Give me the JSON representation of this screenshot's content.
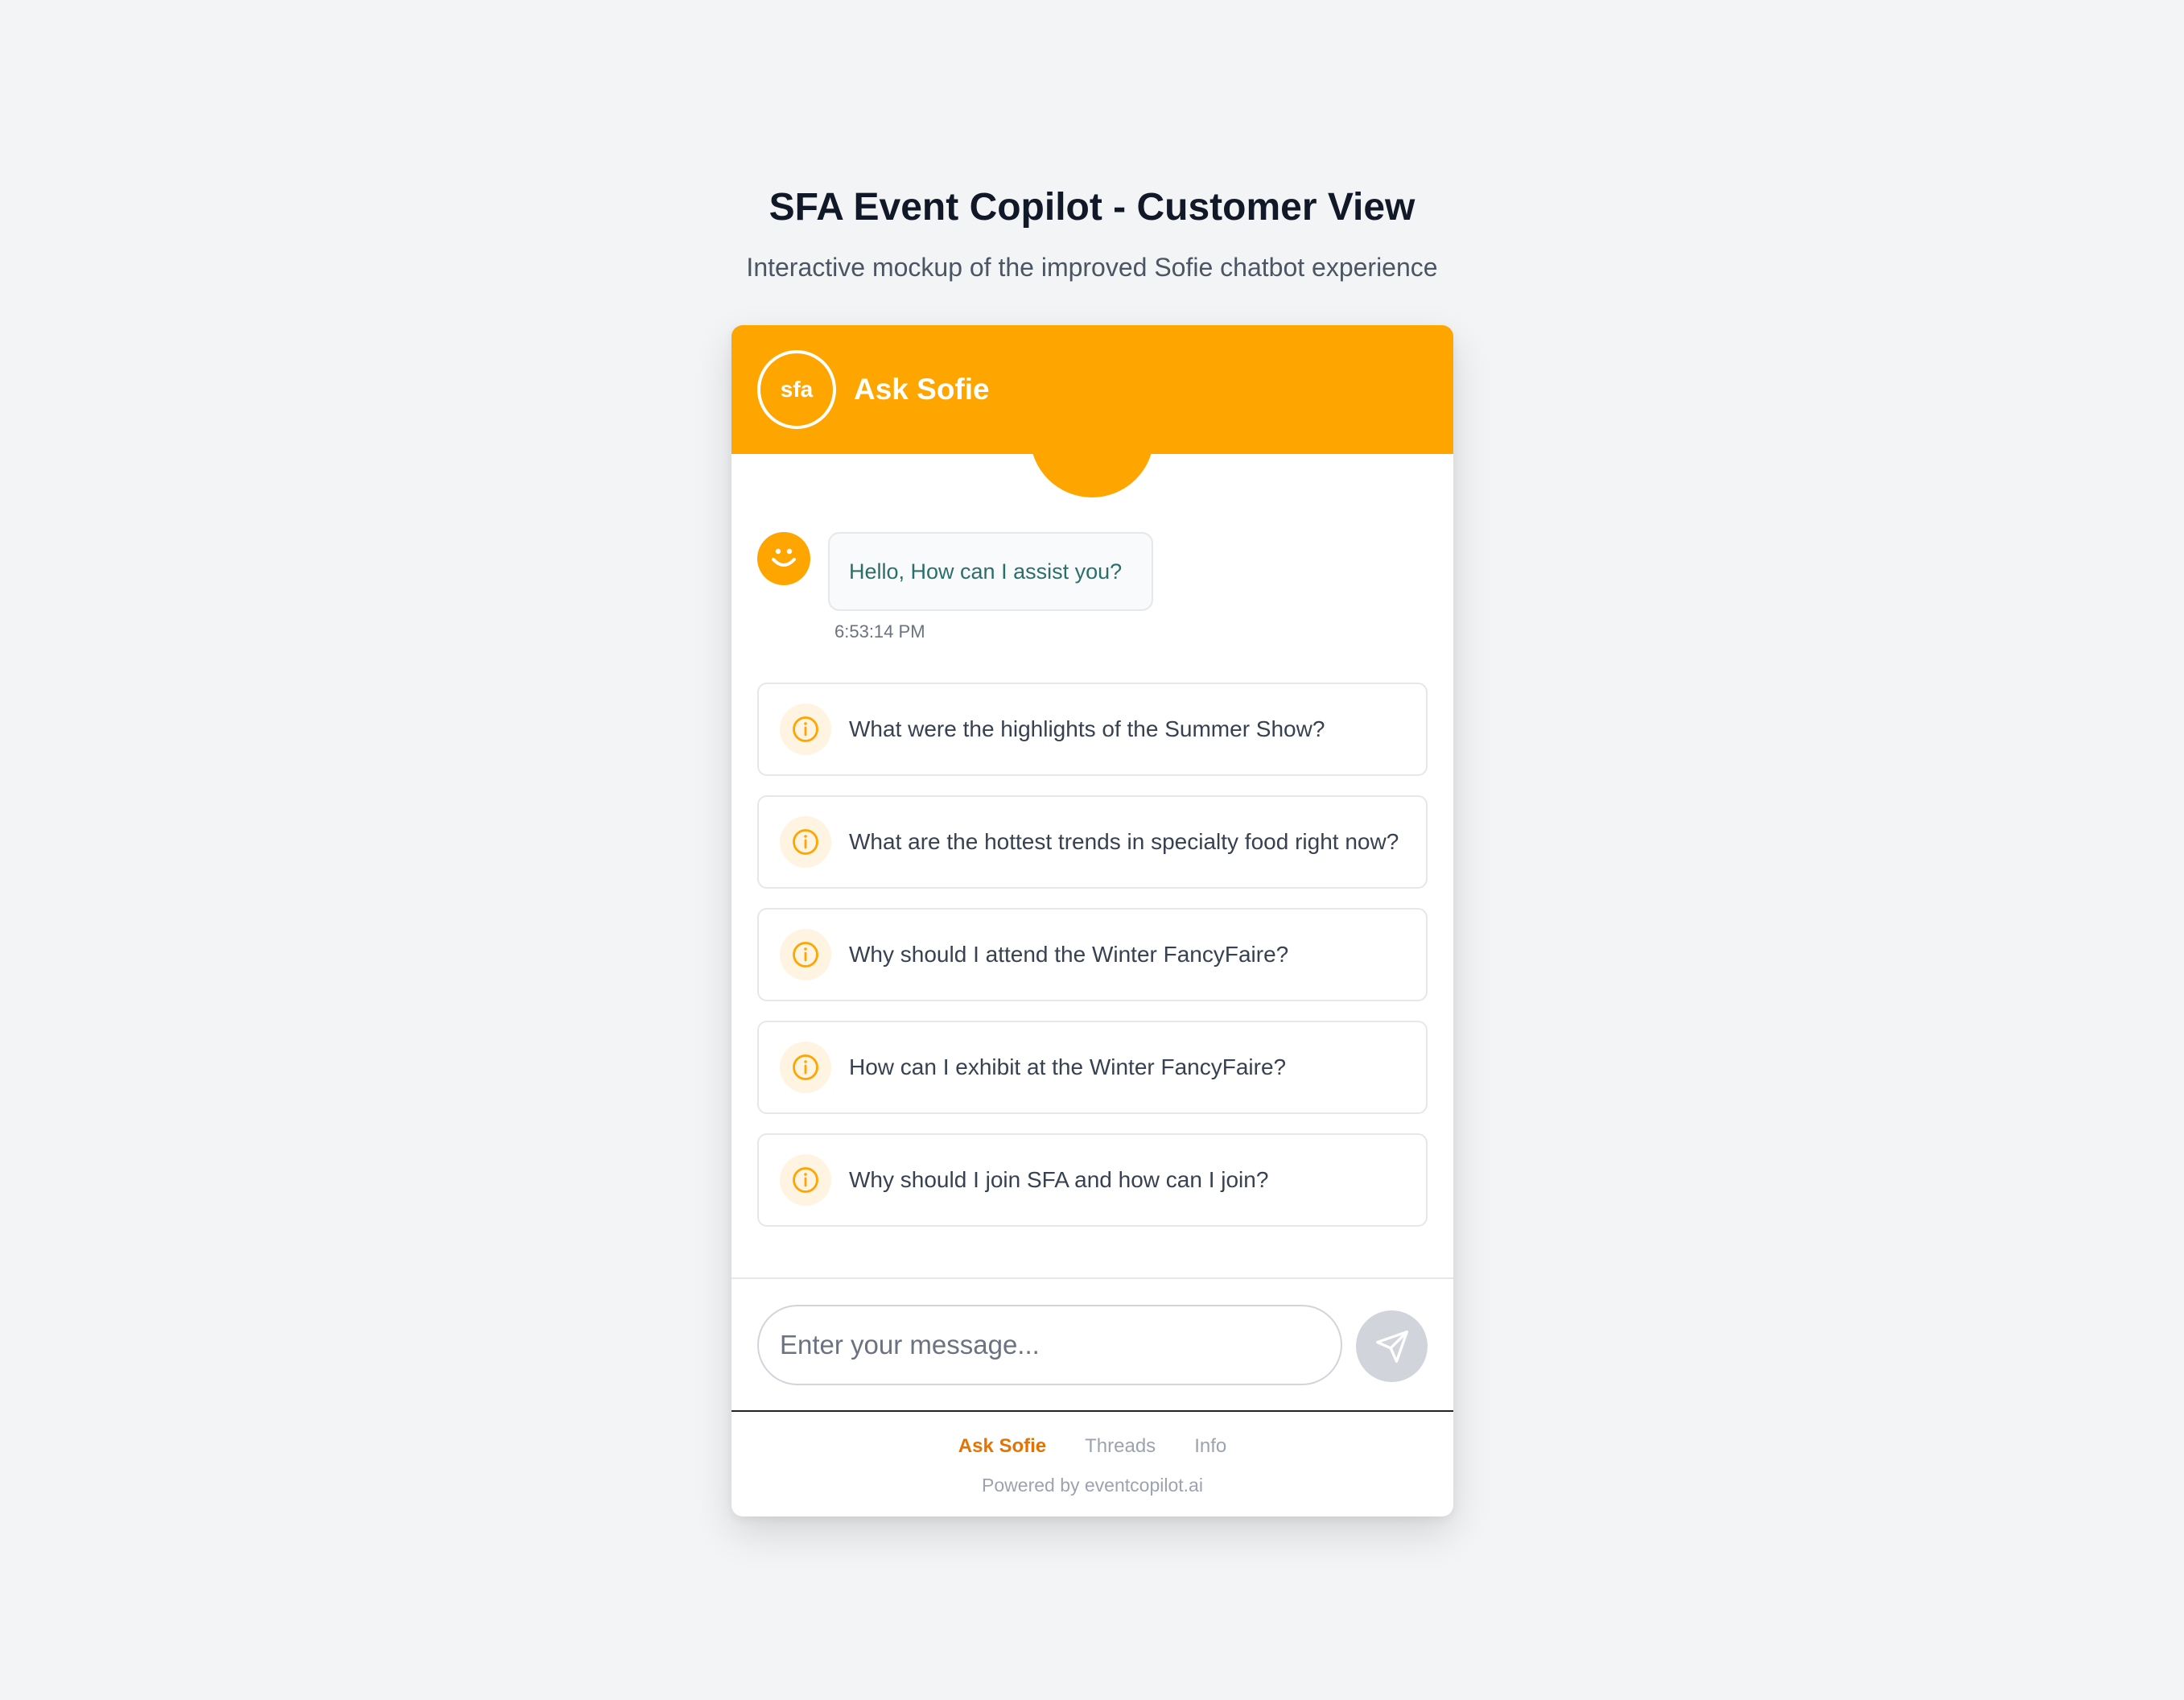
{
  "page": {
    "title": "SFA Event Copilot - Customer View",
    "subtitle": "Interactive mockup of the improved Sofie chatbot experience"
  },
  "colors": {
    "accent": "#ffa500",
    "page_background": "#f3f4f6",
    "bot_text": "#2c6e6a",
    "nav_active": "#e67300"
  },
  "widget": {
    "header": {
      "logo_text": "sfa",
      "title": "Ask Sofie"
    },
    "messages": [
      {
        "sender": "bot",
        "avatar_icon": "smiley-face-icon",
        "text": "Hello, How can I assist you?",
        "time": "6:53:14 PM"
      }
    ],
    "suggestions": [
      {
        "icon": "info-icon",
        "text": "What were the highlights of the Summer Show?"
      },
      {
        "icon": "info-icon",
        "text": "What are the hottest trends in specialty food right now?"
      },
      {
        "icon": "info-icon",
        "text": "Why should I attend the Winter FancyFaire?"
      },
      {
        "icon": "info-icon",
        "text": "How can I exhibit at the Winter FancyFaire?"
      },
      {
        "icon": "info-icon",
        "text": "Why should I join SFA and how can I join?"
      }
    ],
    "composer": {
      "placeholder": "Enter your message...",
      "value": "",
      "send_icon": "send-icon"
    },
    "nav": {
      "items": [
        {
          "label": "Ask Sofie",
          "active": true
        },
        {
          "label": "Threads",
          "active": false
        },
        {
          "label": "Info",
          "active": false
        }
      ]
    },
    "footer": {
      "powered_by": "Powered by eventcopilot.ai"
    }
  }
}
